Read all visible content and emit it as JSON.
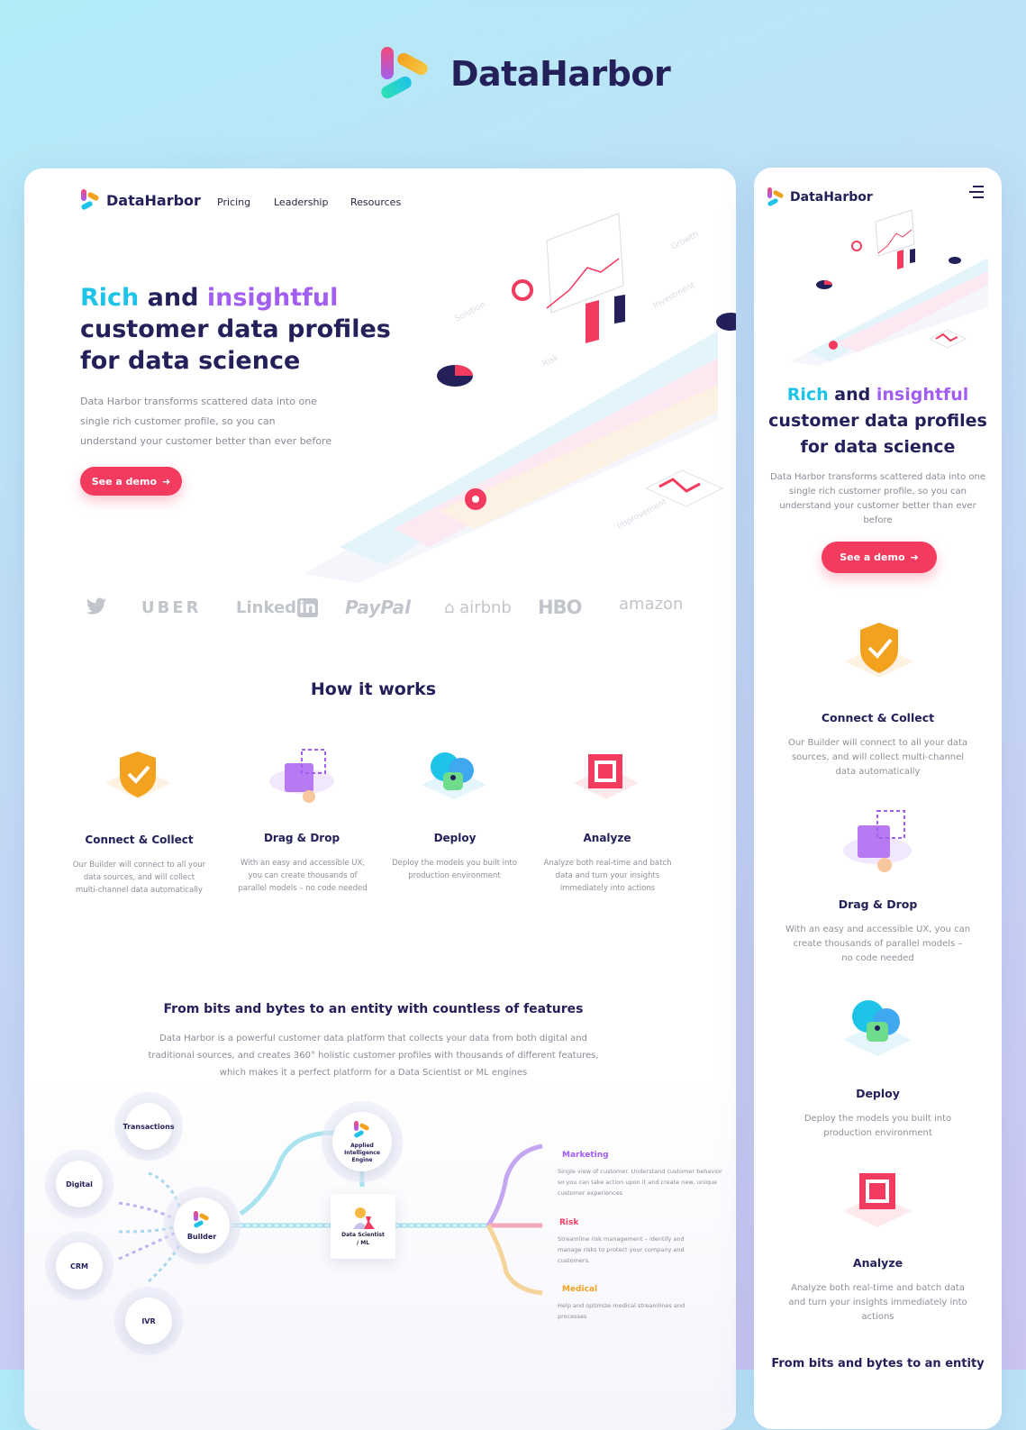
{
  "brand": {
    "name": "DataHarbor"
  },
  "desktop": {
    "nav": {
      "items": [
        "Pricing",
        "Leadership",
        "Resources"
      ]
    },
    "hero": {
      "title_rich": "Rich",
      "title_and": " and ",
      "title_insightful": "insightful",
      "title_line2": "customer data profiles",
      "title_line3": "for data science",
      "desc_lines": [
        "Data Harbor transforms scattered data into one",
        "single rich customer profile, so you can",
        "understand your customer better than ever before"
      ],
      "cta": "See a demo",
      "illustration_labels": [
        "Solution",
        "Growth",
        "Investment",
        "Risk",
        "Improvement"
      ]
    },
    "logos": [
      "UBER",
      "Linked",
      "in",
      "PayPal",
      "airbnb",
      "HBO",
      "amazon"
    ],
    "how": {
      "title": "How it works",
      "steps": [
        {
          "title": "Connect & Collect",
          "desc": [
            "Our Builder will connect to all your",
            "data sources, and will collect",
            "multi-channel data automatically"
          ]
        },
        {
          "title": "Drag & Drop",
          "desc": [
            "With an easy and accessible UX,",
            "you can create thousands of",
            "parallel models – no code needed"
          ]
        },
        {
          "title": "Deploy",
          "desc": [
            "Deploy the models you built into",
            "production environment"
          ]
        },
        {
          "title": "Analyze",
          "desc": [
            "Analyze both real-time and batch",
            "data and turn your insights",
            "immediately into actions"
          ]
        }
      ]
    },
    "bits": {
      "title": "From bits and bytes to an entity with countless of features",
      "desc": [
        "Data Harbor is a powerful customer data platform that collects your data from both digital and",
        "traditional sources, and creates 360° holistic customer profiles with thousands of different features,",
        "which makes it a perfect platform for a Data Scientist or ML engines"
      ],
      "sources": [
        "Transactions",
        "Digital",
        "CRM",
        "IVR"
      ],
      "builder": "Builder",
      "engine": [
        "Applied",
        "Intelligence",
        "Engine"
      ],
      "scientist": [
        "Data Scientist",
        "/ ML"
      ],
      "outcomes": [
        {
          "title": "Marketing",
          "color": "#a25ef0",
          "desc": [
            "Single view of customer. Understand customer behavior",
            "so you can take action upon it and create new, unique",
            "customer experiences"
          ]
        },
        {
          "title": "Risk",
          "color": "#f23b5f",
          "desc": [
            "Streamline risk management – identify and",
            "manage risks to protect your company and",
            "customers."
          ]
        },
        {
          "title": "Medical",
          "color": "#f3a21f",
          "desc": [
            "Help and optimize medical streamlines and",
            "processes"
          ]
        }
      ]
    }
  },
  "mobile": {
    "hero": {
      "title_rich": "Rich",
      "title_and": " and ",
      "title_insightful": "insightful",
      "title_line2": "customer data profiles",
      "title_line3": "for data science",
      "desc_lines": [
        "Data Harbor transforms scattered data into one",
        "single rich customer profile, so you can",
        "understand your customer better than ever",
        "before"
      ],
      "cta": "See a demo"
    },
    "steps": [
      {
        "title": "Connect & Collect",
        "desc": [
          "Our Builder will connect to all your data",
          "sources, and will collect multi-channel",
          "data automatically"
        ]
      },
      {
        "title": "Drag & Drop",
        "desc": [
          "With an easy and accessible UX, you can",
          "create thousands of parallel models –",
          "no code needed"
        ]
      },
      {
        "title": "Deploy",
        "desc": [
          "Deploy the models you built into",
          "production environment"
        ]
      },
      {
        "title": "Analyze",
        "desc": [
          "Analyze both real-time and batch data",
          "and turn your insights immediately into",
          "actions"
        ]
      }
    ],
    "bottom_title": "From bits and bytes to an entity"
  },
  "colors": {
    "brand_dark": "#23205a",
    "cyan": "#1ec3e8",
    "purple": "#a25ef0",
    "cta": "#f23b5f",
    "orange": "#f3a21f"
  }
}
